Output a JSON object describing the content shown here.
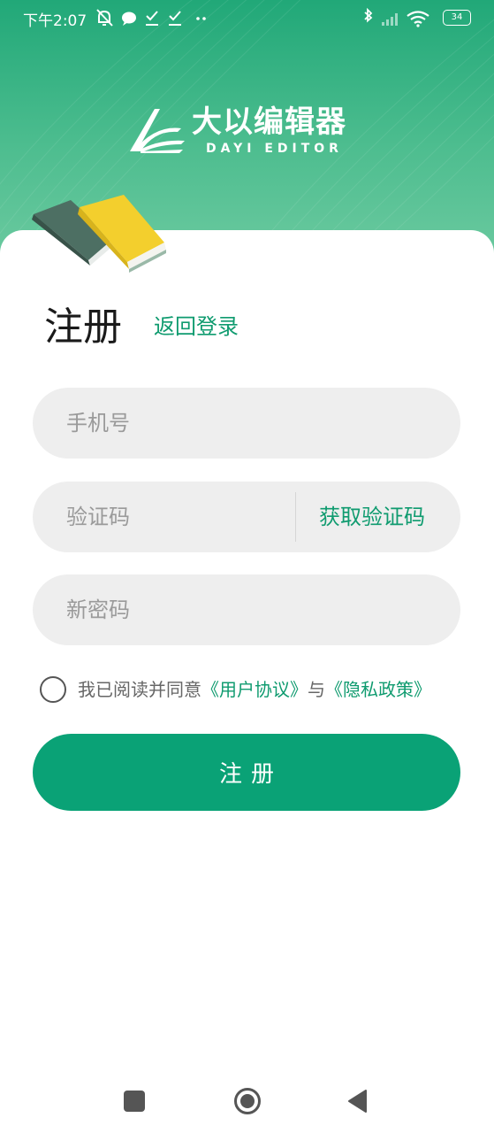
{
  "status_bar": {
    "time": "下午2:07",
    "battery": "34"
  },
  "logo": {
    "title": "大以编辑器",
    "subtitle": "DAYI EDITOR"
  },
  "page": {
    "title": "注册",
    "back_login": "返回登录"
  },
  "form": {
    "phone_placeholder": "手机号",
    "code_placeholder": "验证码",
    "get_code": "获取验证码",
    "password_placeholder": "新密码"
  },
  "agreement": {
    "prefix": "我已阅读并同意",
    "user_agreement": "《用户协议》",
    "conjunction": "与",
    "privacy_policy": "《隐私政策》"
  },
  "submit_label": "注册",
  "colors": {
    "accent": "#0aa276",
    "link": "#0f9b6f",
    "header_top": "#21a878",
    "header_bottom": "#6ccaa0"
  },
  "icons": {
    "status_left": [
      "mute-bell-icon",
      "chat-bubble-icon",
      "check-download-icon",
      "check-download-icon",
      "more-dots-icon"
    ],
    "status_right": [
      "bluetooth-icon",
      "signal-icon",
      "wifi-icon",
      "battery-icon"
    ],
    "nav": [
      "recent-apps-icon",
      "home-icon",
      "back-icon"
    ]
  }
}
